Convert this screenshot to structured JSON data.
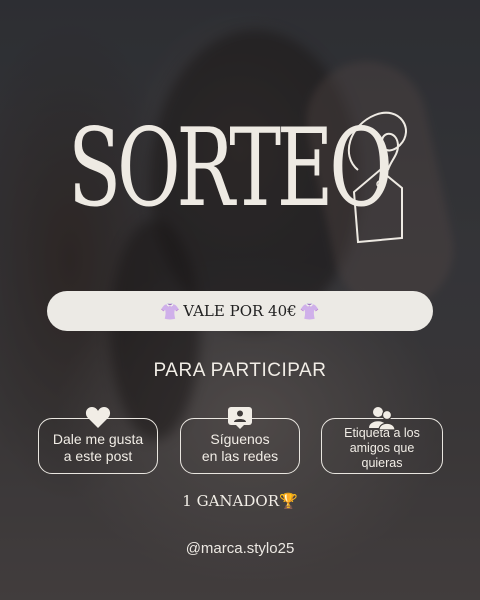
{
  "title": "SORTEO",
  "voucher": {
    "left_emoji": "👚",
    "text": "VALE POR 40€",
    "right_emoji": "👚"
  },
  "participar": "PARA PARTICIPAR",
  "steps": [
    {
      "icon": "heart-icon",
      "line1": "Dale me gusta",
      "line2": "a este post"
    },
    {
      "icon": "follow-user-icon",
      "line1": "Síguenos",
      "line2": "en las redes"
    },
    {
      "icon": "users-icon",
      "line1": "Etiqueta a los",
      "line2": "amigos que quieras"
    }
  ],
  "winner": {
    "text": "1 GANADOR",
    "emoji": "🏆"
  },
  "handle": "@marca.stylo25",
  "colors": {
    "text": "#f1ede6",
    "bar": "#eceae5",
    "accent_pink": "#e59ad0"
  }
}
